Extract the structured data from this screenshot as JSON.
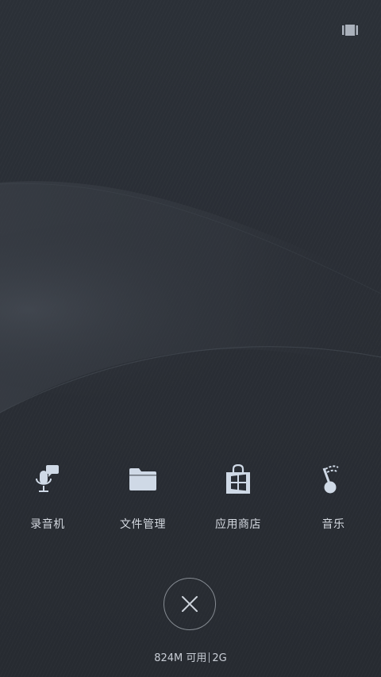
{
  "screen": {
    "background_color": "#272b31",
    "icon_color": "#cfd9e6"
  },
  "top_bar": {
    "recents_icon": "recent-apps-icon"
  },
  "apps": [
    {
      "label": "录音机",
      "icon": "microphone-chat-icon"
    },
    {
      "label": "文件管理",
      "icon": "folder-icon"
    },
    {
      "label": "应用商店",
      "icon": "store-bag-icon"
    },
    {
      "label": "音乐",
      "icon": "music-note-icon"
    }
  ],
  "close_button": {
    "icon": "close-icon"
  },
  "memory": {
    "available": "824M 可用",
    "total": "2G"
  }
}
